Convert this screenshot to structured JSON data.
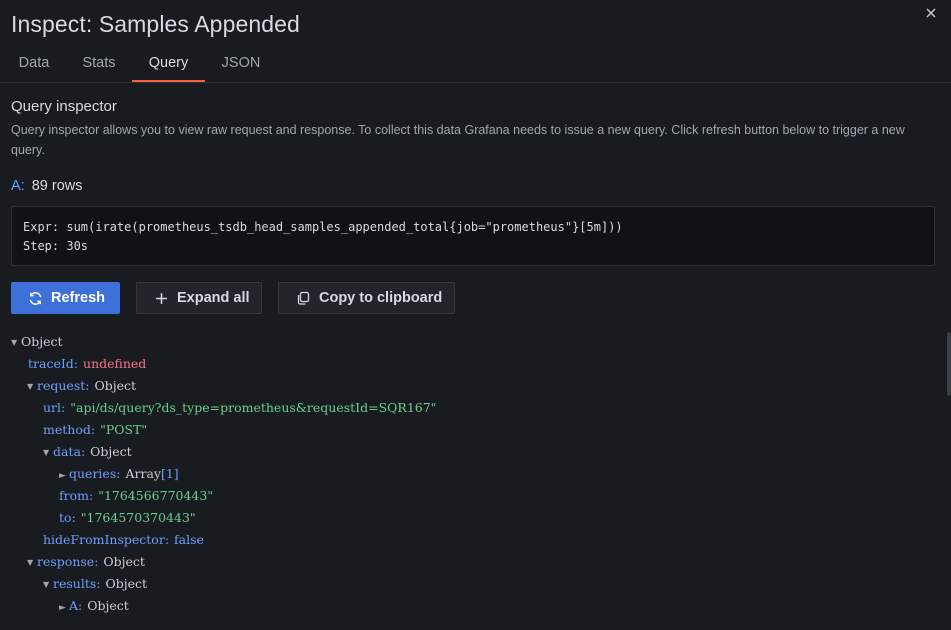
{
  "drawer": {
    "title": "Inspect: Samples Appended",
    "close_icon": "close-icon"
  },
  "tabs": [
    {
      "label": "Data",
      "active": false
    },
    {
      "label": "Stats",
      "active": false
    },
    {
      "label": "Query",
      "active": true
    },
    {
      "label": "JSON",
      "active": false
    }
  ],
  "query_inspector": {
    "title": "Query inspector",
    "description": "Query inspector allows you to view raw request and response. To collect this data Grafana needs to issue a new query. Click refresh button below to trigger a new query.",
    "ref_id": "A:",
    "rows": "89 rows",
    "expr_line": "Expr: sum(irate(prometheus_tsdb_head_samples_appended_total{job=\"prometheus\"}[5m]))",
    "step_line": "Step: 30s"
  },
  "buttons": {
    "refresh": "Refresh",
    "expand_all": "Expand all",
    "copy_clipboard": "Copy to clipboard"
  },
  "tree": {
    "root_type": "Object",
    "traceId_key": "traceId",
    "traceId_val": "undefined",
    "request_key": "request",
    "request_type": "Object",
    "url_key": "url",
    "url_val": "\"api/ds/query?ds_type=prometheus&requestId=SQR167\"",
    "method_key": "method",
    "method_val": "\"POST\"",
    "data_key": "data",
    "data_type": "Object",
    "queries_key": "queries",
    "queries_type": "Array",
    "queries_len": "[1]",
    "from_key": "from",
    "from_val": "\"1764566770443\"",
    "to_key": "to",
    "to_val": "\"1764570370443\"",
    "hide_key": "hideFromInspector",
    "hide_val": "false",
    "response_key": "response",
    "response_type": "Object",
    "results_key": "results",
    "results_type": "Object",
    "a_key": "A",
    "a_type": "Object"
  },
  "colors": {
    "background": "#181b1f",
    "primary_button": "#3d71d9",
    "active_tab_underline": "#f55f3e",
    "key": "#6e9fff",
    "string": "#6ccf8e",
    "undefined": "#ff7389"
  }
}
